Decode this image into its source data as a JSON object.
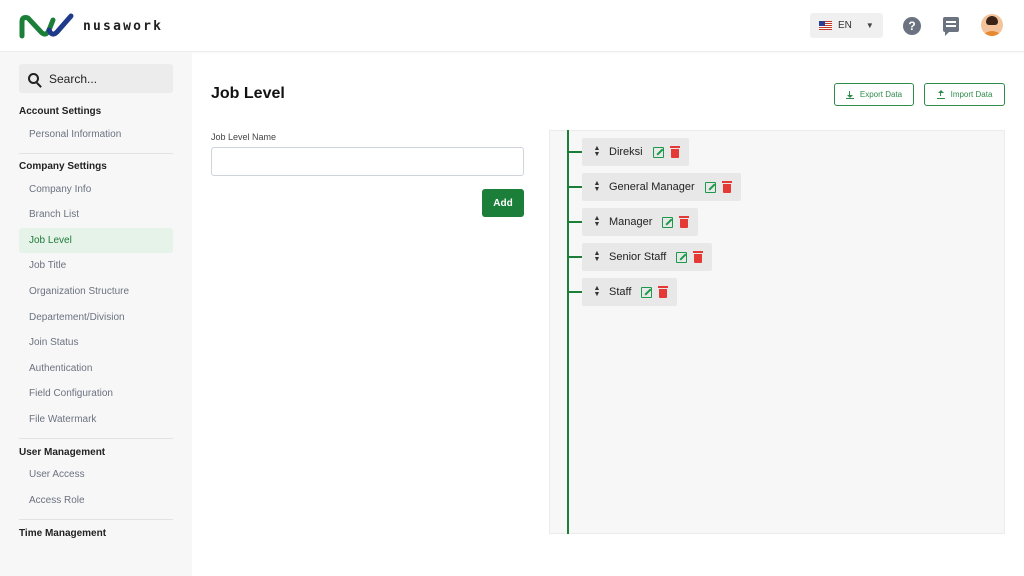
{
  "brand": {
    "name": "nusawork",
    "accent": "#1b7f3a"
  },
  "header": {
    "language": "EN",
    "flag_icon": "us-flag-icon",
    "help_icon": "help-circle-icon",
    "chat_icon": "chat-icon",
    "avatar_icon": "user-avatar"
  },
  "sidebar": {
    "search_placeholder": "Search...",
    "sections": [
      {
        "title": "Account Settings",
        "items": [
          "Personal Information"
        ]
      },
      {
        "title": "Company Settings",
        "items": [
          "Company Info",
          "Branch List",
          "Job Level",
          "Job Title",
          "Organization Structure",
          "Departement/Division",
          "Join Status",
          "Authentication",
          "Field Configuration",
          "File Watermark"
        ]
      },
      {
        "title": "User Management",
        "items": [
          "User Access",
          "Access Role"
        ]
      },
      {
        "title": "Time Management",
        "items": []
      }
    ],
    "active_item": "Job Level"
  },
  "main": {
    "title": "Job Level",
    "export_label": "Export Data",
    "import_label": "Import Data",
    "field_label": "Job Level Name",
    "field_value": "",
    "add_label": "Add"
  },
  "tree": {
    "nodes": [
      "Direksi",
      "General Manager",
      "Manager",
      "Senior Staff",
      "Staff"
    ]
  }
}
